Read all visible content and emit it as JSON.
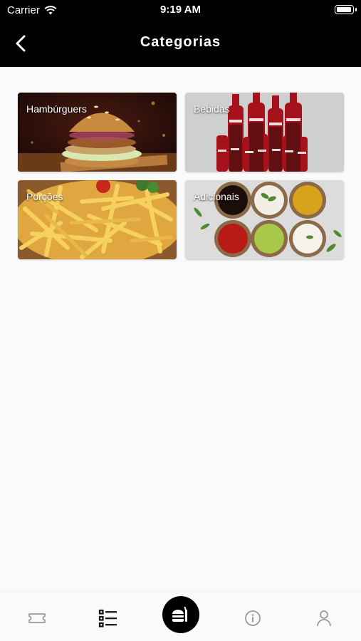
{
  "status_bar": {
    "carrier": "Carrier",
    "time": "9:19 AM",
    "battery_level": 1.0
  },
  "header": {
    "title": "Categorias",
    "back_icon": "chevron-left-icon"
  },
  "categories": [
    {
      "label": "Hambúrguers",
      "image": "burger-photo"
    },
    {
      "label": "Bebidas",
      "image": "soda-bottles-photo"
    },
    {
      "label": "Porções",
      "image": "fries-photo"
    },
    {
      "label": "Adicionais",
      "image": "sauces-photo"
    }
  ],
  "tab_bar": {
    "items": [
      {
        "icon": "ticket-icon"
      },
      {
        "icon": "list-icon",
        "active": true
      },
      {
        "icon": "food-menu-icon",
        "center": true
      },
      {
        "icon": "info-icon"
      },
      {
        "icon": "user-icon"
      }
    ],
    "colors": {
      "active": "#111111",
      "inactive": "#9a9a9a"
    }
  }
}
